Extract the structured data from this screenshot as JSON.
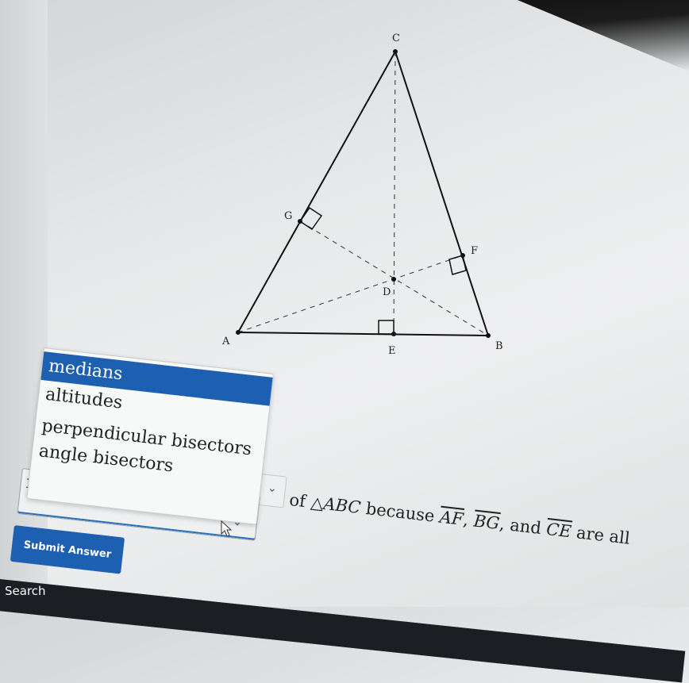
{
  "figure": {
    "points": {
      "A": "A",
      "B": "B",
      "C": "C",
      "D": "D",
      "E": "E",
      "F": "F",
      "G": "G"
    }
  },
  "dropdown": {
    "options": [
      "medians",
      "altitudes",
      "perpendicular bisectors",
      "angle bisectors"
    ],
    "highlighted": "medians",
    "selected_value": "medians"
  },
  "sentence": {
    "of": "of",
    "triangle": "△ABC",
    "because": "because",
    "seg1": "AF",
    "sep1": ",",
    "seg2": "BG",
    "and": ", and",
    "seg3": "CE",
    "tail": "are all"
  },
  "submit_label": "Submit Answer",
  "taskbar": {
    "search_label": "Search"
  },
  "colors": {
    "accent": "#1d5fb0"
  }
}
